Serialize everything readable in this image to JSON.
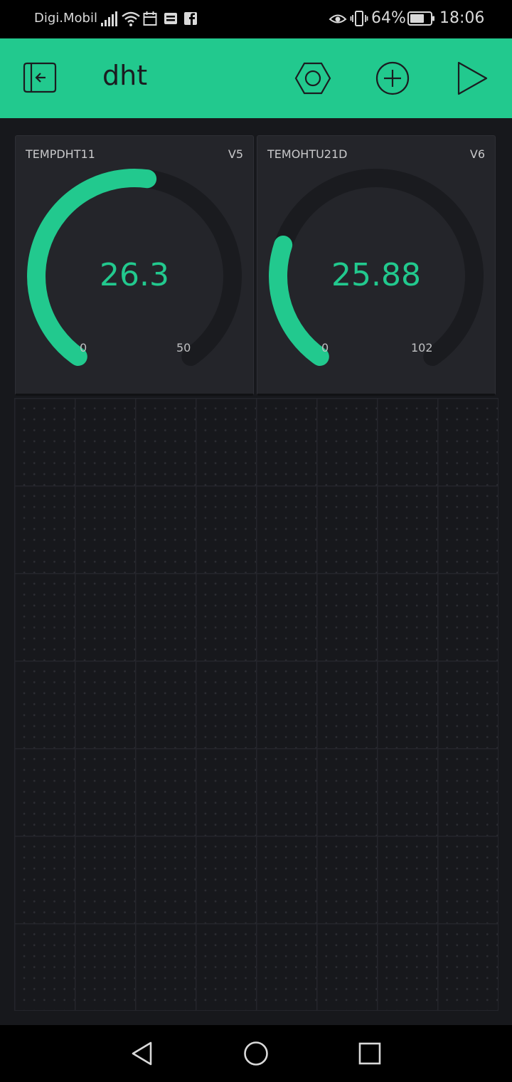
{
  "status_bar": {
    "carrier": "Digi.Mobil",
    "battery": "64%",
    "time": "18:06"
  },
  "header": {
    "title": "dht",
    "icons": [
      "back-exit-icon",
      "settings-hex-icon",
      "add-widget-icon",
      "play-icon"
    ]
  },
  "colors": {
    "accent": "#22c98e",
    "background": "#17181c",
    "widget": "#24252a",
    "track": "#1a1b1f"
  },
  "widgets": [
    {
      "label": "TEMPDHT11",
      "pin": "V5",
      "value": "26.3",
      "min": "0",
      "max": "50",
      "value_num": 26.3,
      "min_num": 0,
      "max_num": 50
    },
    {
      "label": "TEMOHTU21D",
      "pin": "V6",
      "value": "25.88",
      "min": "0",
      "max": "102",
      "value_num": 25.88,
      "min_num": 0,
      "max_num": 102
    }
  ],
  "nav_bar": {
    "icons": [
      "back-triangle-icon",
      "home-circle-icon",
      "recents-square-icon"
    ]
  }
}
